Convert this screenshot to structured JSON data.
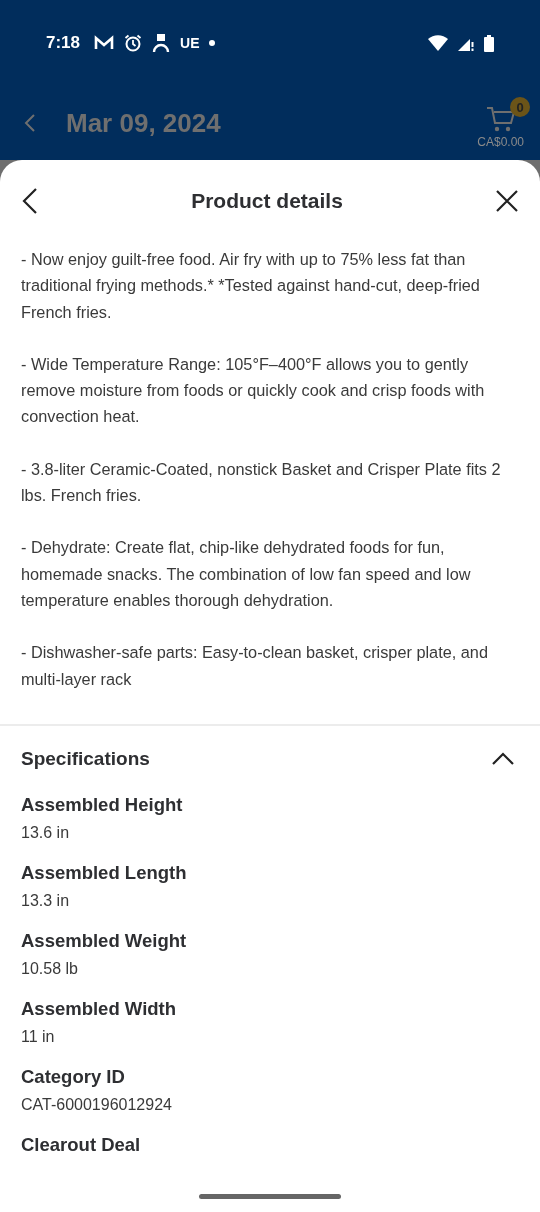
{
  "status_bar": {
    "time": "7:18",
    "carrier": "UE"
  },
  "header": {
    "title": "Mar 09, 2024",
    "cart_count": "0",
    "cart_total": "CA$0.00"
  },
  "sheet": {
    "title": "Product details",
    "paragraphs": [
      "- Now enjoy guilt-free food. Air fry with up to 75% less fat than traditional frying methods.* *Tested against hand-cut, deep-fried French fries.",
      "- Wide Temperature Range: 105°F–400°F allows you to gently remove moisture from foods or quickly cook and crisp foods with convection heat.",
      "- 3.8-liter Ceramic-Coated, nonstick Basket and Crisper Plate fits 2 lbs. French fries.",
      "- Dehydrate: Create flat, chip-like dehydrated foods for fun, homemade snacks. The combination of low fan speed and low temperature enables thorough dehydration.",
      "- Dishwasher-safe parts: Easy-to-clean basket, crisper plate, and multi-layer rack"
    ],
    "specifications": {
      "title": "Specifications",
      "expanded": true,
      "items": [
        {
          "label": "Assembled Height",
          "value": "13.6 in"
        },
        {
          "label": "Assembled Length",
          "value": "13.3 in"
        },
        {
          "label": "Assembled Weight",
          "value": "10.58 lb"
        },
        {
          "label": "Assembled Width",
          "value": "11 in"
        },
        {
          "label": "Category ID",
          "value": "CAT-6000196012924"
        },
        {
          "label": "Clearout Deal"
        }
      ]
    }
  }
}
